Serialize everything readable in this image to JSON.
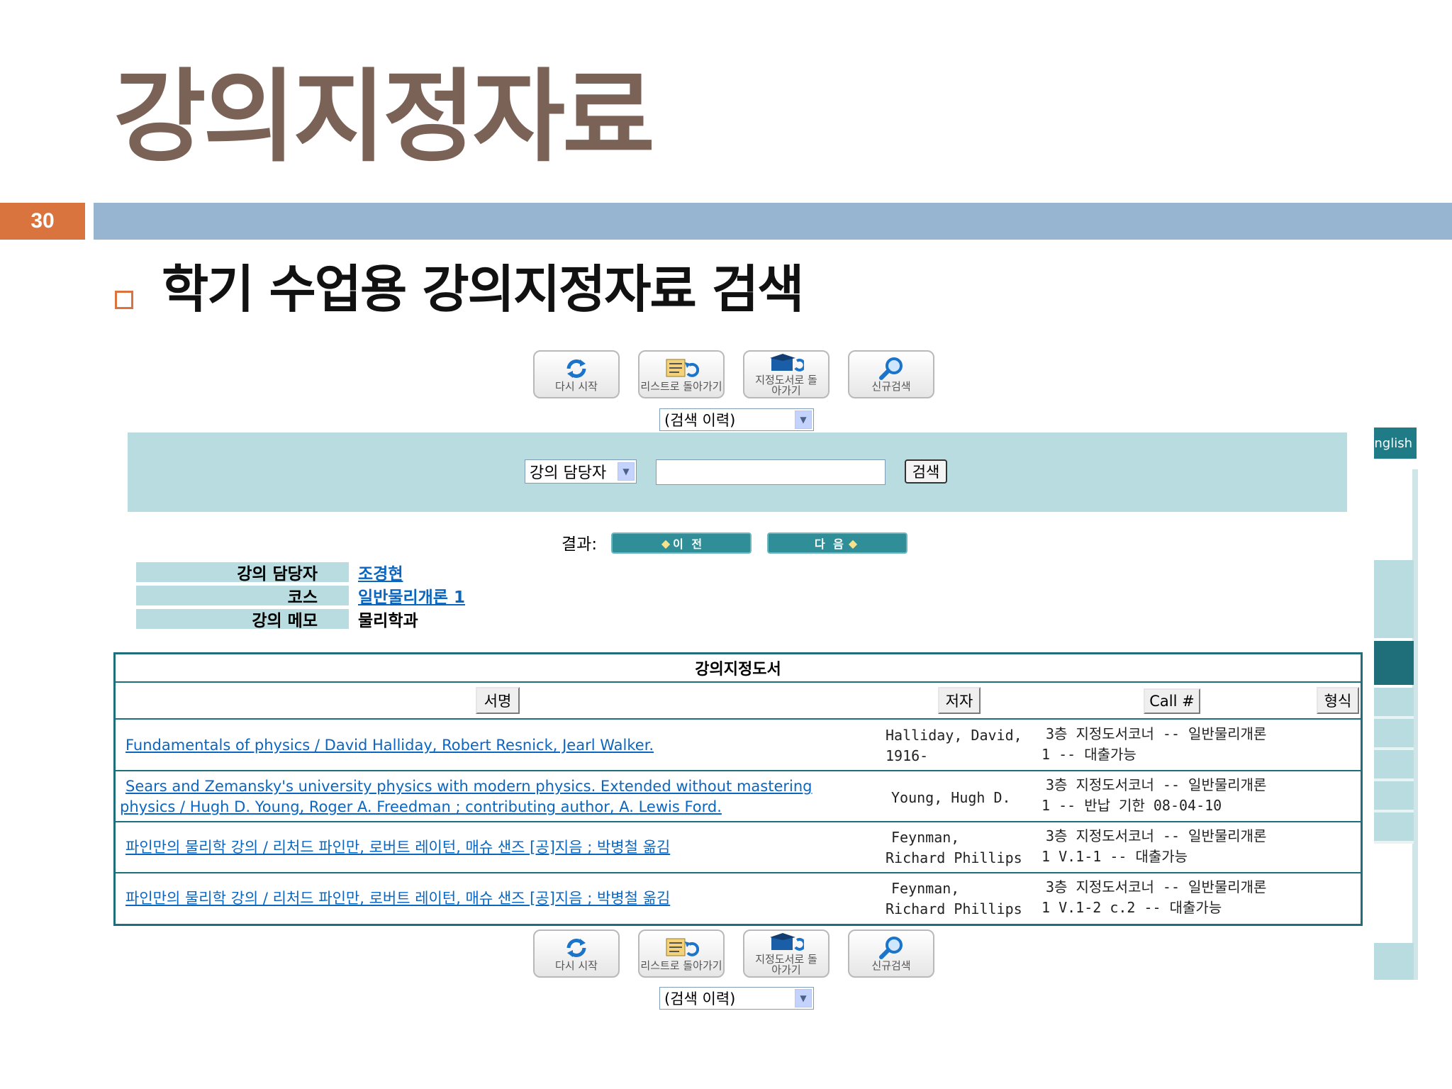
{
  "slide": {
    "title": "강의지정자료",
    "page_number": "30",
    "bullet_text": "학기 수업용 강의지정자료 검색"
  },
  "toolbar": {
    "buttons": [
      {
        "label": "다시 시작",
        "icon": "refresh-icon"
      },
      {
        "label": "리스트로 돌아가기",
        "icon": "list-return-icon"
      },
      {
        "label": "지정도서로 돌아가기",
        "icon": "reserve-return-icon"
      },
      {
        "label": "신규검색",
        "icon": "magnifier-icon"
      }
    ],
    "history_select": "(검색 이력)"
  },
  "search": {
    "field_select": "강의 담당자",
    "query": "",
    "submit_label": "검색",
    "english_tab": "nglish"
  },
  "results": {
    "label": "결과:",
    "prev_label": "이 전",
    "next_label": "다 음"
  },
  "course_info": {
    "rows": [
      {
        "label": "강의 담당자",
        "value": "조경현",
        "link": true
      },
      {
        "label": "코스",
        "value": "일반물리개론 1",
        "link": true
      },
      {
        "label": "강의 메모",
        "value": "물리학과",
        "link": false
      }
    ]
  },
  "book_table": {
    "caption": "강의지정도서",
    "headers": [
      "서명",
      "저자",
      "Call #",
      "형식"
    ],
    "rows": [
      {
        "title": "Fundamentals of physics / David Halliday, Robert Resnick, Jearl Walker.",
        "author_l1": "Halliday, David,",
        "author_l2": "1916-",
        "call_l1": "3층 지정도서코너 -- 일반물리개론",
        "call_l2": "1 -- 대출가능"
      },
      {
        "title_l1": "Sears and Zemansky's university physics with modern physics. Extended without mastering",
        "title_l2": "physics / Hugh D. Young, Roger A. Freedman ; contributing author, A. Lewis Ford.",
        "author_l1": "Young, Hugh D.",
        "call_l1": "3층 지정도서코너 -- 일반물리개론",
        "call_l2": "1 -- 반납 기한 08-04-10"
      },
      {
        "title": "파인만의 물리학 강의 / 리처드 파인만, 로버트 레이턴, 매슈 샌즈 [공]지음 ; 박병철 옮김",
        "author_l1": "Feynman,",
        "author_l2": "Richard Phillips",
        "call_l1": "3층 지정도서코너 -- 일반물리개론",
        "call_l2": "1 V.1-1 -- 대출가능"
      },
      {
        "title": "파인만의 물리학 강의 / 리처드 파인만, 로버트 레이턴, 매슈 샌즈 [공]지음 ; 박병철 옮김",
        "author_l1": "Feynman,",
        "author_l2": "Richard Phillips",
        "call_l1": "3층 지정도서코너 -- 일반물리개론",
        "call_l2": "1 V.1-2 c.2 -- 대출가능"
      }
    ]
  },
  "colors": {
    "title": "#7b6257",
    "accent_orange": "#d9743e",
    "header_bar": "#97b4d0",
    "panel_teal": "#b8dcdf",
    "table_border": "#1f6f7a",
    "link": "#0b66c0"
  }
}
